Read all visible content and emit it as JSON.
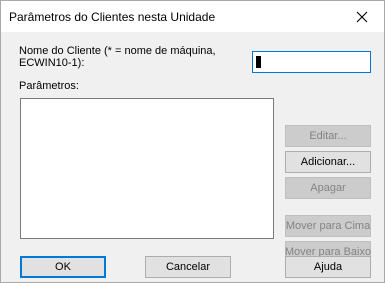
{
  "window": {
    "title": "Parâmetros do Clientes nesta Unidade"
  },
  "form": {
    "client_name_label_line1": "Nome do Cliente (* = nome de máquina,",
    "client_name_label_line2": "ECWIN10-1):",
    "client_name_value": "",
    "parameters_label": "Parâmetros:"
  },
  "side_buttons": {
    "edit": "Editar...",
    "add": "Adicionar...",
    "delete": "Apagar",
    "move_up": "Mover para Cima",
    "move_down": "Mover para Baixo"
  },
  "bottom_buttons": {
    "ok": "OK",
    "cancel": "Cancelar",
    "help": "Ajuda"
  },
  "colors": {
    "focus_border": "#0078d7",
    "dialog_bg": "#f0f0f0",
    "button_bg": "#e1e1e1",
    "disabled_text": "#838383"
  }
}
